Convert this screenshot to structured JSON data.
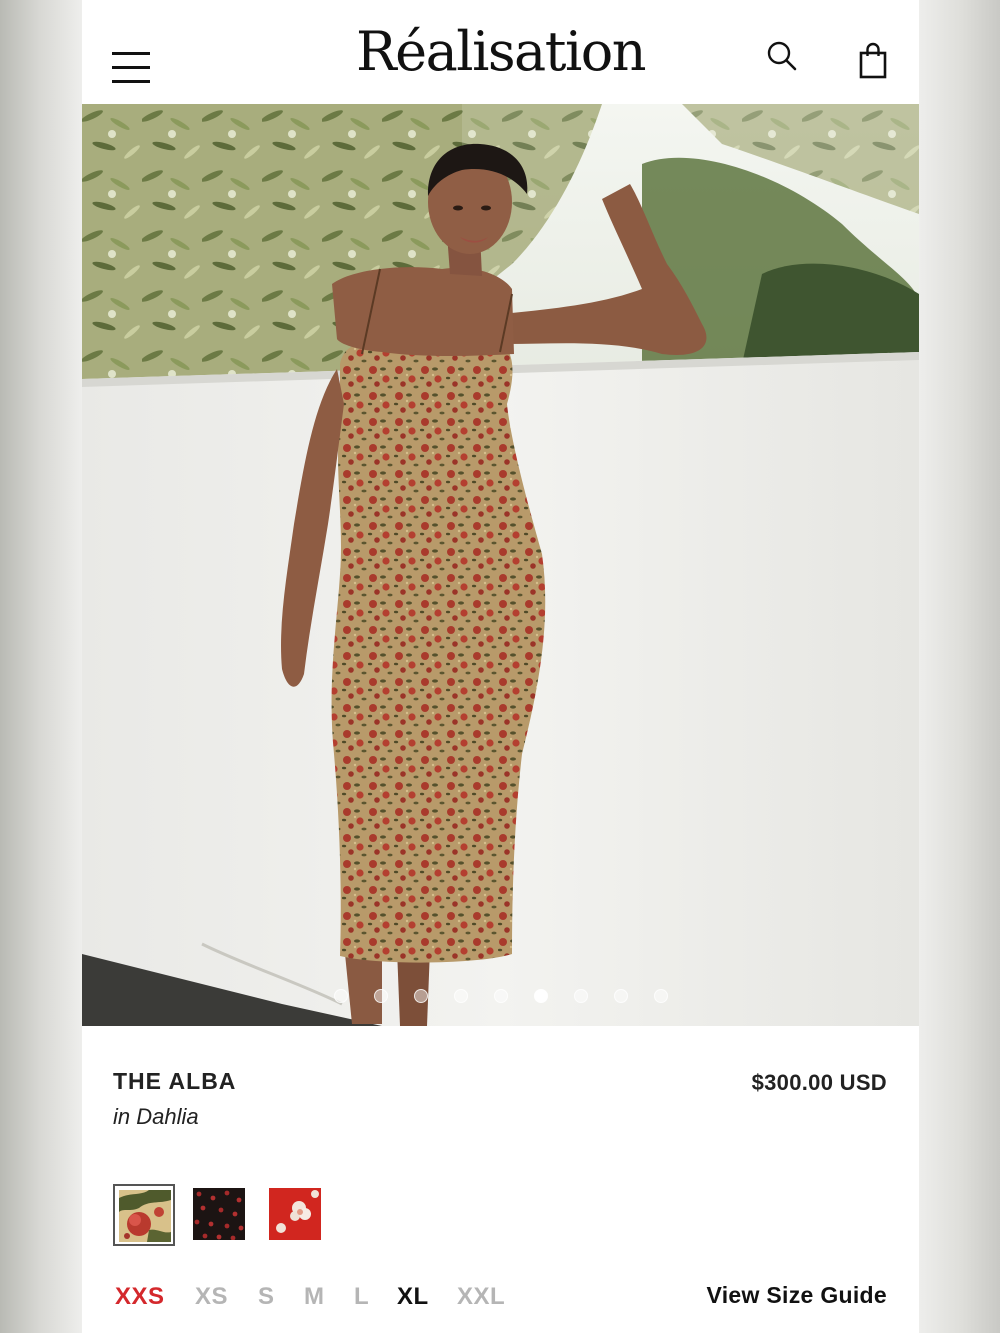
{
  "header": {
    "logo": "Réalisation",
    "menu_icon": "hamburger-menu-icon",
    "search_icon": "search-icon",
    "bag_icon": "shopping-bag-icon"
  },
  "carousel": {
    "total_slides": 9,
    "active_slide": 6
  },
  "product": {
    "title": "THE ALBA",
    "variant": "in Dahlia",
    "price": "$300.00 USD"
  },
  "swatches": [
    {
      "name": "dahlia",
      "selected": true
    },
    {
      "name": "black-floral",
      "selected": false
    },
    {
      "name": "red-floral",
      "selected": false
    }
  ],
  "sizes": {
    "options": [
      "XXS",
      "XS",
      "S",
      "M",
      "L",
      "XL",
      "XXL"
    ],
    "selected": "XXS",
    "available": [
      "XL"
    ]
  },
  "size_guide_label": "View Size Guide",
  "colors": {
    "selected_size": "#d4282c",
    "unavailable_size": "#b5b5b5",
    "text": "#111111"
  }
}
